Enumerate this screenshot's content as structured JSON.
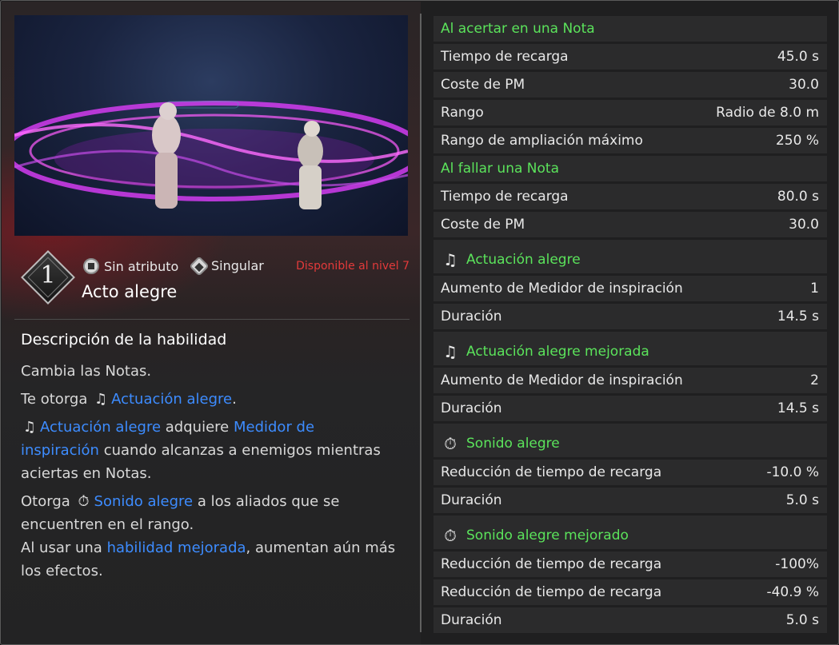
{
  "skill": {
    "rank": "1",
    "attribute": "Sin atributo",
    "type": "Singular",
    "availability": "Disponible al nivel 7",
    "name": "Acto alegre"
  },
  "description": {
    "title": "Descripción de la habilidad",
    "line1": "Cambia las Notas.",
    "p2_a": "Te otorga",
    "p2_link": "Actuación alegre",
    "p2_b": ".",
    "p3_link1": "Actuación alegre",
    "p3_a": "adquiere",
    "p3_link2": "Medidor de inspiración",
    "p3_b": "cuando alcanzas a enemigos mientras aciertas en Notas.",
    "p4_a": "Otorga",
    "p4_link": "Sonido alegre",
    "p4_b": "a los aliados que se encuentren en el rango.",
    "p4_c": "Al usar una",
    "p4_link2": "habilidad mejorada",
    "p4_d": ", aumentan aún más los efectos."
  },
  "stats": [
    {
      "kind": "head",
      "label": "Al acertar en una Nota",
      "value": ""
    },
    {
      "kind": "row",
      "label": "Tiempo de recarga",
      "value": "45.0 s"
    },
    {
      "kind": "row",
      "label": "Coste de PM",
      "value": "30.0"
    },
    {
      "kind": "row",
      "label": "Rango",
      "value": "Radio de 8.0 m"
    },
    {
      "kind": "row",
      "label": "Rango de ampliación máximo",
      "value": "250 %"
    },
    {
      "kind": "head",
      "label": "Al fallar una Nota",
      "value": ""
    },
    {
      "kind": "row",
      "label": "Tiempo de recarga",
      "value": "80.0 s"
    },
    {
      "kind": "row",
      "label": "Coste de PM",
      "value": "30.0"
    },
    {
      "kind": "sub",
      "icon": "music-note-icon",
      "label": "Actuación alegre",
      "value": ""
    },
    {
      "kind": "row",
      "label": "Aumento de Medidor de inspiración",
      "value": "1"
    },
    {
      "kind": "row",
      "label": "Duración",
      "value": "14.5 s"
    },
    {
      "kind": "sub",
      "icon": "music-note-up-icon",
      "label": "Actuación alegre mejorada",
      "value": ""
    },
    {
      "kind": "row",
      "label": "Aumento de Medidor de inspiración",
      "value": "2"
    },
    {
      "kind": "row",
      "label": "Duración",
      "value": "14.5 s"
    },
    {
      "kind": "sub",
      "icon": "stopwatch-note-icon",
      "label": "Sonido alegre",
      "value": ""
    },
    {
      "kind": "row",
      "label": "Reducción de tiempo de recarga",
      "value": "-10.0 %"
    },
    {
      "kind": "row",
      "label": "Duración",
      "value": "5.0 s"
    },
    {
      "kind": "sub",
      "icon": "stopwatch-note-up-icon",
      "label": "Sonido alegre mejorado",
      "value": ""
    },
    {
      "kind": "row",
      "label": "Reducción de tiempo de recarga",
      "value": "-100%"
    },
    {
      "kind": "row",
      "label": "Reducción de tiempo de recarga",
      "value": "-40.9 %"
    },
    {
      "kind": "row",
      "label": "Duración",
      "value": "5.0 s"
    }
  ],
  "colors": {
    "heading_green": "#5be35b",
    "link_blue": "#3d8cff",
    "availability_red": "#e23a3a"
  }
}
